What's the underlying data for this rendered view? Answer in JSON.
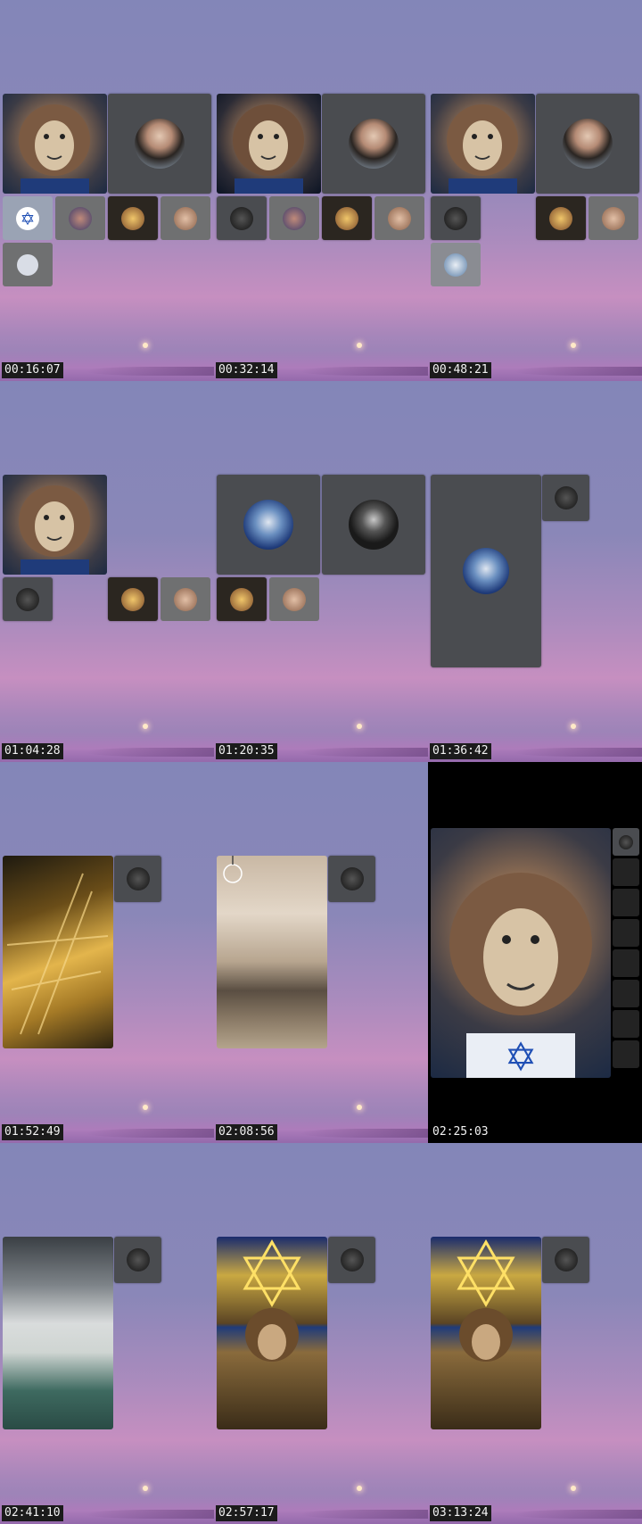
{
  "frames": [
    {
      "timestamp": "00:16:07"
    },
    {
      "timestamp": "00:32:14"
    },
    {
      "timestamp": "00:48:21"
    },
    {
      "timestamp": "01:04:28"
    },
    {
      "timestamp": "01:20:35"
    },
    {
      "timestamp": "01:36:42"
    },
    {
      "timestamp": "01:52:49"
    },
    {
      "timestamp": "02:08:56"
    },
    {
      "timestamp": "02:25:03"
    },
    {
      "timestamp": "02:41:10"
    },
    {
      "timestamp": "02:57:17"
    },
    {
      "timestamp": "03:13:24"
    }
  ],
  "colors": {
    "background_top": "#8386b8",
    "background_pink": "#c68fc0",
    "tile_gray": "#4a4c50",
    "timestamp_bg": "#1b1b1b"
  },
  "icons": [
    "lion-avatar-icon",
    "woman-avatar-icon",
    "star-of-david-icon",
    "person-avatar-icon",
    "camera-off-icon"
  ]
}
